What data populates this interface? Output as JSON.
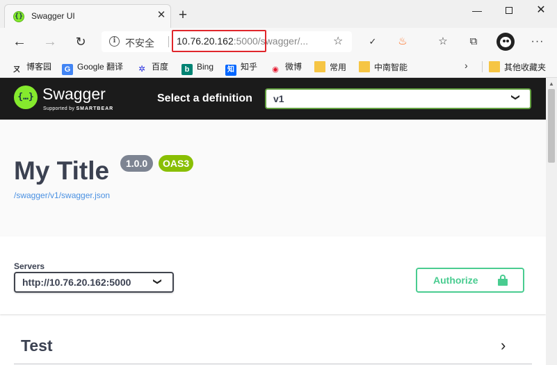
{
  "browser": {
    "tab": {
      "title": "Swagger UI",
      "favicon": "{}"
    },
    "window_controls": {
      "minimize": "—",
      "close": "✕"
    },
    "address_bar": {
      "security_label": "不安全",
      "url_host": "10.76.20.162",
      "url_port": ":5000",
      "url_path": "/swagger/..."
    },
    "bookmarks": [
      {
        "label": "博客园",
        "icon": "blog-icon",
        "glyph": "ㄡ",
        "color": "#333333"
      },
      {
        "label": "Google 翻译",
        "icon": "google-translate-icon",
        "glyph": "G",
        "color": "#4285f4"
      },
      {
        "label": "百度",
        "icon": "baidu-icon",
        "glyph": "🐾",
        "color": "#2932e1"
      },
      {
        "label": "Bing",
        "icon": "bing-icon",
        "glyph": "b",
        "color": "#008373"
      },
      {
        "label": "知乎",
        "icon": "zhihu-icon",
        "glyph": "知",
        "color": "#0066ff"
      },
      {
        "label": "微博",
        "icon": "weibo-icon",
        "glyph": "◉",
        "color": "#e6162d"
      },
      {
        "label": "常用",
        "icon": "folder-icon",
        "glyph": "",
        "color": "#f6c544"
      },
      {
        "label": "中南智能",
        "icon": "folder-icon",
        "glyph": "",
        "color": "#f6c544"
      }
    ],
    "other_bookmarks": "其他收藏夹"
  },
  "swagger": {
    "logo_text": "Swagger",
    "logo_sub_prefix": "Supported by",
    "logo_sub_brand": "SMARTBEAR",
    "logo_glyph": "{…}",
    "select_definition_label": "Select a definition",
    "selected_definition": "v1",
    "title": "My Title",
    "version": "1.0.0",
    "oas": "OAS3",
    "spec_link": "/swagger/v1/swagger.json",
    "servers_label": "Servers",
    "selected_server": "http://10.76.20.162:5000",
    "authorize_label": "Authorize",
    "tags": [
      {
        "name": "Test"
      }
    ]
  },
  "colors": {
    "swagger_green": "#85ea2d",
    "topbar_bg": "#1b1b1b",
    "authorize_green": "#49cc90",
    "oas_badge": "#89bf04",
    "version_badge": "#7d8492",
    "link_blue": "#4990e2",
    "highlight_red": "#e0262b"
  }
}
